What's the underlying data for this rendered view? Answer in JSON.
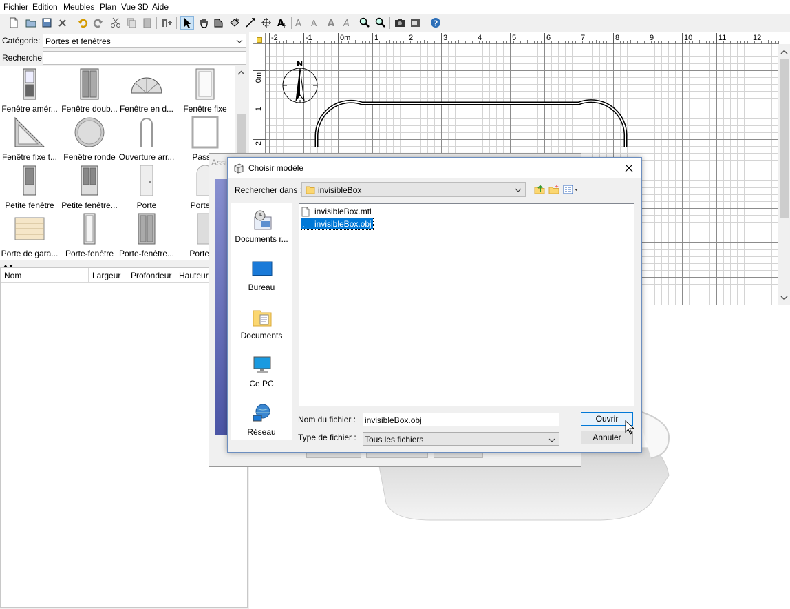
{
  "menu": {
    "items": [
      "Fichier",
      "Edition",
      "Meubles",
      "Plan",
      "Vue 3D",
      "Aide"
    ]
  },
  "toolbar": {
    "icons": [
      "new-file-icon",
      "open-folder-icon",
      "save-icon",
      "preferences-icon",
      "undo-icon",
      "redo-icon",
      "cut-icon",
      "copy-icon",
      "paste-icon",
      "add-furniture-icon",
      "select-arrow-icon",
      "pan-hand-icon",
      "create-walls-icon",
      "create-rooms-icon",
      "create-dimensions-icon",
      "create-labels-icon",
      "add-text-icon",
      "text-style-1-icon",
      "text-style-2-icon",
      "text-style-3-icon",
      "text-style-4-icon",
      "zoom-in-icon",
      "zoom-out-icon",
      "create-photo-icon",
      "create-video-icon",
      "help-icon"
    ]
  },
  "catalog": {
    "category_label": "Catégorie:",
    "category_value": "Portes et fenêtres",
    "search_label": "Recherche:",
    "search_value": "",
    "items": [
      {
        "name": "Fenêtre amér...",
        "icon": "window-american-icon"
      },
      {
        "name": "Fenêtre doub...",
        "icon": "window-double-icon"
      },
      {
        "name": "Fenêtre en d...",
        "icon": "window-half-round-icon"
      },
      {
        "name": "Fenêtre fixe",
        "icon": "window-fixed-icon"
      },
      {
        "name": "Fenêtre fixe t...",
        "icon": "window-triangle-icon"
      },
      {
        "name": "Fenêtre ronde",
        "icon": "window-round-icon"
      },
      {
        "name": "Ouverture arr...",
        "icon": "arched-opening-icon"
      },
      {
        "name": "Passe-",
        "icon": "door-frame-icon"
      },
      {
        "name": "Petite fenêtre",
        "icon": "small-window-icon"
      },
      {
        "name": "Petite fenêtre...",
        "icon": "small-window-double-icon"
      },
      {
        "name": "Porte",
        "icon": "door-icon"
      },
      {
        "name": "Porte ar",
        "icon": "arched-door-icon"
      },
      {
        "name": "Porte de gara...",
        "icon": "garage-door-icon"
      },
      {
        "name": "Porte-fenêtre",
        "icon": "french-window-icon"
      },
      {
        "name": "Porte-fenêtre...",
        "icon": "french-window-double-icon"
      },
      {
        "name": "Porte ou",
        "icon": "door-open-icon"
      }
    ]
  },
  "furniture_table": {
    "columns": [
      "Nom",
      "Largeur",
      "Profondeur",
      "Hauteur"
    ]
  },
  "plan": {
    "ruler_h": [
      "-2",
      "-1",
      "0m",
      "1",
      "2",
      "3",
      "4",
      "5",
      "6",
      "7",
      "8",
      "9",
      "10",
      "11",
      "12"
    ],
    "ruler_v": [
      "0m",
      "1",
      "2"
    ],
    "compass_label": "N"
  },
  "background_dialog": {
    "title_fragment": "Assis"
  },
  "dialog": {
    "title": "Choisir modèle",
    "look_in_label": "Rechercher dans :",
    "look_in_value": "invisibleBox",
    "places": [
      {
        "label": "Documents r...",
        "icon": "recent-documents-icon"
      },
      {
        "label": "Bureau",
        "icon": "desktop-icon"
      },
      {
        "label": "Documents",
        "icon": "documents-folder-icon"
      },
      {
        "label": "Ce PC",
        "icon": "computer-icon"
      },
      {
        "label": "Réseau",
        "icon": "network-icon"
      }
    ],
    "files": [
      {
        "name": "invisibleBox.mtl",
        "selected": false
      },
      {
        "name": "invisibleBox.obj",
        "selected": true
      }
    ],
    "filename_label": "Nom du fichier :",
    "filename_value": "invisibleBox.obj",
    "filetype_label": "Type de fichier :",
    "filetype_value": "Tous les fichiers",
    "open_button": "Ouvrir",
    "cancel_button": "Annuler",
    "accent_color": "#0078d7"
  }
}
